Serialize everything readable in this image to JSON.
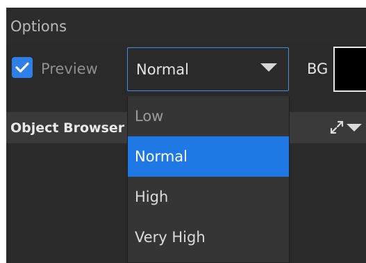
{
  "options": {
    "title": "Options",
    "preview_checked": true,
    "preview_label": "Preview",
    "quality_value": "Normal",
    "bg_label": "BG",
    "bg_color": "#000000",
    "accent_color": "#2f7fe8"
  },
  "object_browser": {
    "title": "Object Browser",
    "expand_icon": "expand-arrows-icon",
    "menu_icon": "caret-down-icon"
  },
  "dropdown": {
    "items": [
      {
        "label": "Low",
        "selected": false
      },
      {
        "label": "Normal",
        "selected": true
      },
      {
        "label": "High",
        "selected": false
      },
      {
        "label": "Very High",
        "selected": false
      }
    ]
  }
}
